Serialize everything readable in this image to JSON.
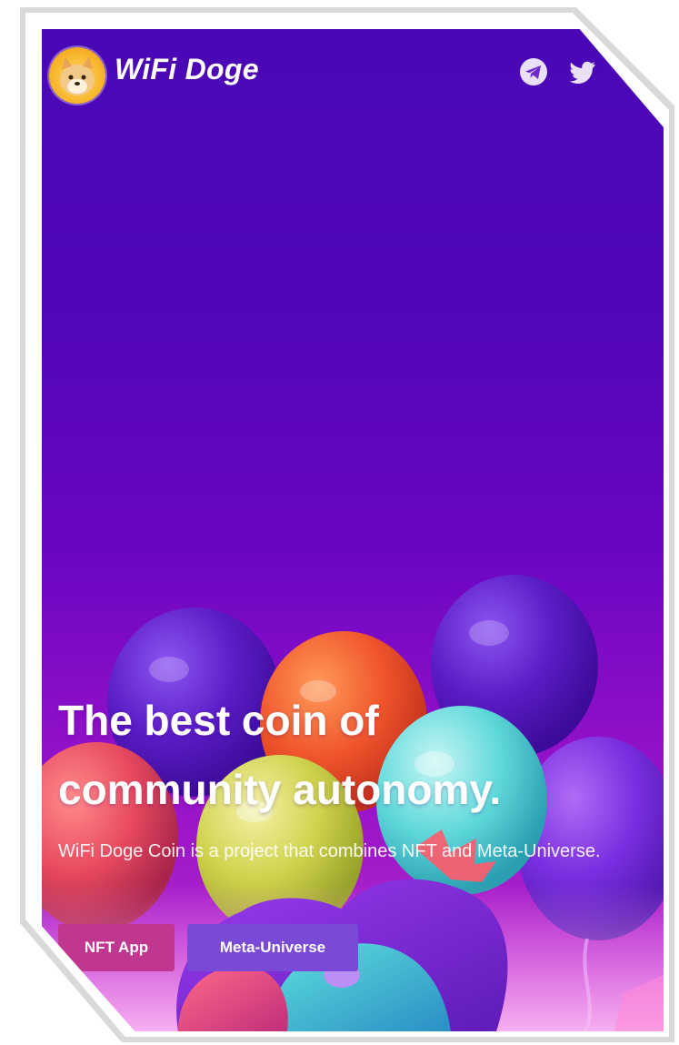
{
  "header": {
    "brand_name": "WiFi Doge",
    "logo_icon": "doge-logo-icon",
    "social": [
      {
        "name": "telegram",
        "icon": "telegram-icon"
      },
      {
        "name": "twitter",
        "icon": "twitter-icon"
      }
    ]
  },
  "hero": {
    "headline_line1": "The best coin of",
    "headline_line2": "community autonomy.",
    "subtitle": "WiFi Doge Coin is a project that combines NFT and Meta-Universe."
  },
  "buttons": {
    "nft_label": "NFT App",
    "meta_label": "Meta-Universe"
  },
  "colors": {
    "background_top": "#4a07b6",
    "background_bottom": "#c238d0",
    "nft_button": "#c0378f",
    "meta_button": "#7a4ad6",
    "text": "#ffffff"
  }
}
